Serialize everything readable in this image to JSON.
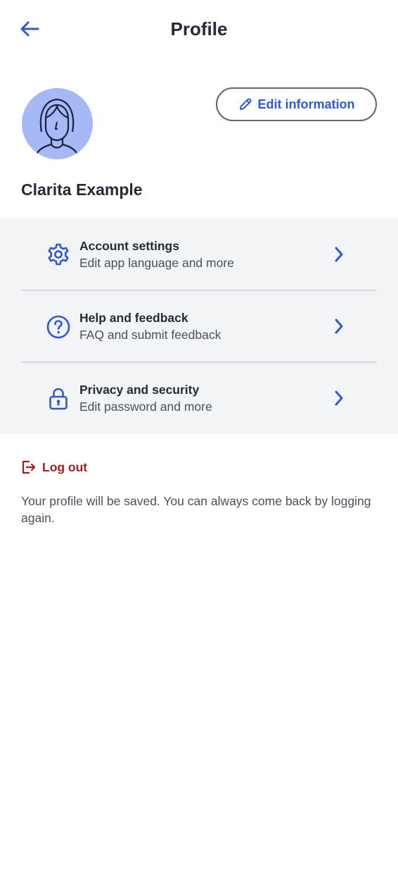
{
  "header": {
    "title": "Profile",
    "back_icon": "arrow-left-icon"
  },
  "profile": {
    "name": "Clarita Example",
    "avatar_icon": "user-avatar-icon",
    "edit_label": "Edit information",
    "edit_icon": "pencil-icon"
  },
  "menu": {
    "items": [
      {
        "title": "Account settings",
        "subtitle": "Edit app language and more",
        "icon": "gear-icon"
      },
      {
        "title": "Help and feedback",
        "subtitle": "FAQ and submit feedback",
        "icon": "question-circle-icon"
      },
      {
        "title": "Privacy and security",
        "subtitle": "Edit password and more",
        "icon": "lock-icon"
      }
    ]
  },
  "logout": {
    "label": "Log out",
    "icon": "logout-icon",
    "note": "Your profile will be saved. You can always come back by logging again."
  },
  "colors": {
    "accent": "#2f58d8",
    "danger": "#a01e1e",
    "avatar_bg": "#a6b8f5",
    "menu_bg": "#f3f4f6"
  }
}
